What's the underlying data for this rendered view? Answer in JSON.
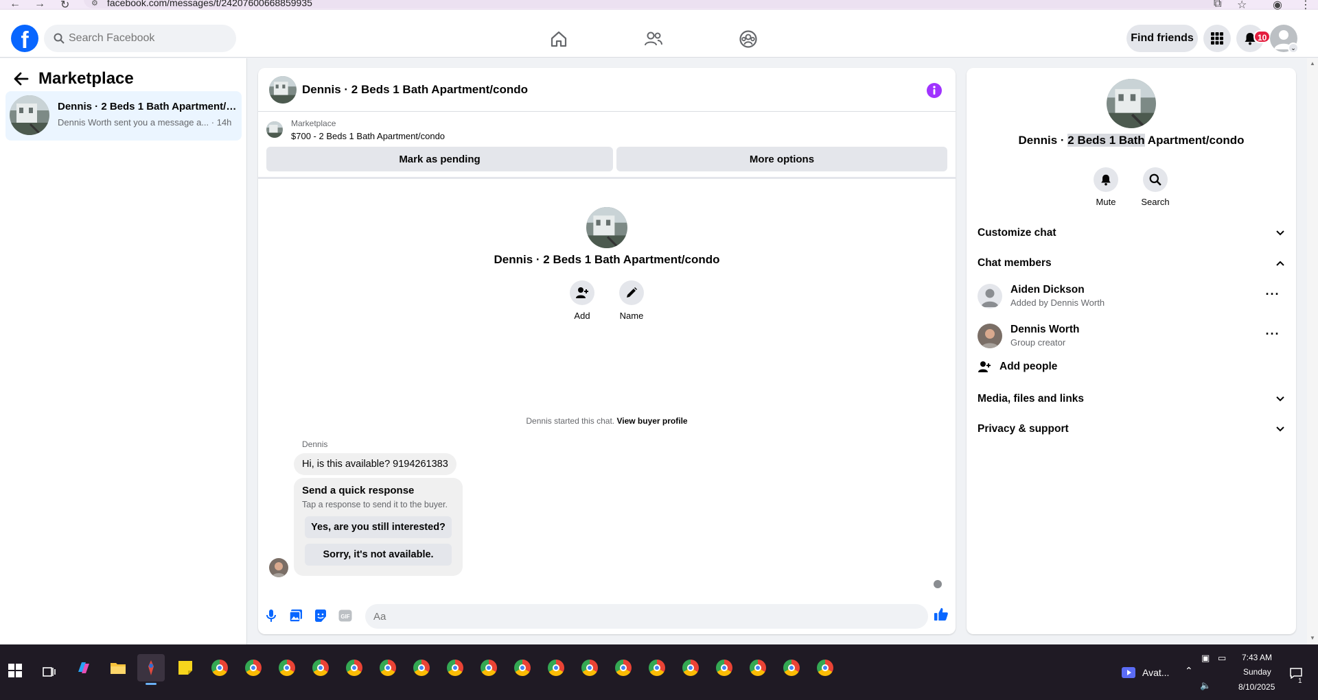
{
  "browser": {
    "url": "facebook.com/messages/t/24207600668859935"
  },
  "topbar": {
    "search_placeholder": "Search Facebook",
    "find_friends_label": "Find friends",
    "notification_count": "10"
  },
  "sidebar": {
    "title": "Marketplace",
    "conversation": {
      "title": "Dennis · 2 Beds 1 Bath Apartment/condo",
      "preview": "Dennis Worth sent you a message a...",
      "time": "· 14h"
    }
  },
  "chat": {
    "header_title": "Dennis · 2 Beds 1 Bath Apartment/condo",
    "marketplace_label": "Marketplace",
    "listing": "$700 - 2 Beds 1 Bath Apartment/condo",
    "mark_pending_label": "Mark as pending",
    "more_options_label": "More options",
    "intro_title": "Dennis · 2 Beds 1 Bath Apartment/condo",
    "add_label": "Add",
    "name_label": "Name",
    "started_text": "Dennis started this chat.",
    "view_profile_label": "View buyer profile",
    "sender_name": "Dennis",
    "message": "Hi, is this available? 9194261383",
    "quick_title": "Send a quick response",
    "quick_sub": "Tap a response to send it to the buyer.",
    "quick_yes": "Yes, are you still interested?",
    "quick_no": "Sorry, it's not available.",
    "composer_placeholder": "Aa"
  },
  "info_panel": {
    "title_pre": "Dennis · ",
    "title_hl": "2 Beds 1 Bath",
    "title_post": " Apartment/condo",
    "mute_label": "Mute",
    "search_label": "Search",
    "customize_label": "Customize chat",
    "members_label": "Chat members",
    "members": [
      {
        "name": "Aiden Dickson",
        "sub": "Added by Dennis Worth"
      },
      {
        "name": "Dennis Worth",
        "sub": "Group creator"
      }
    ],
    "add_people_label": "Add people",
    "media_label": "Media, files and links",
    "privacy_label": "Privacy & support"
  },
  "taskbar": {
    "app_label": "Avat...",
    "time": "7:43 AM",
    "day": "Sunday",
    "date": "8/10/2025",
    "chat_badge": "1"
  },
  "colors": {
    "fb_blue": "#0866ff",
    "selected_bg": "#ebf5ff",
    "info_purple": "#a033ff",
    "notif_red": "#e41e3f"
  }
}
